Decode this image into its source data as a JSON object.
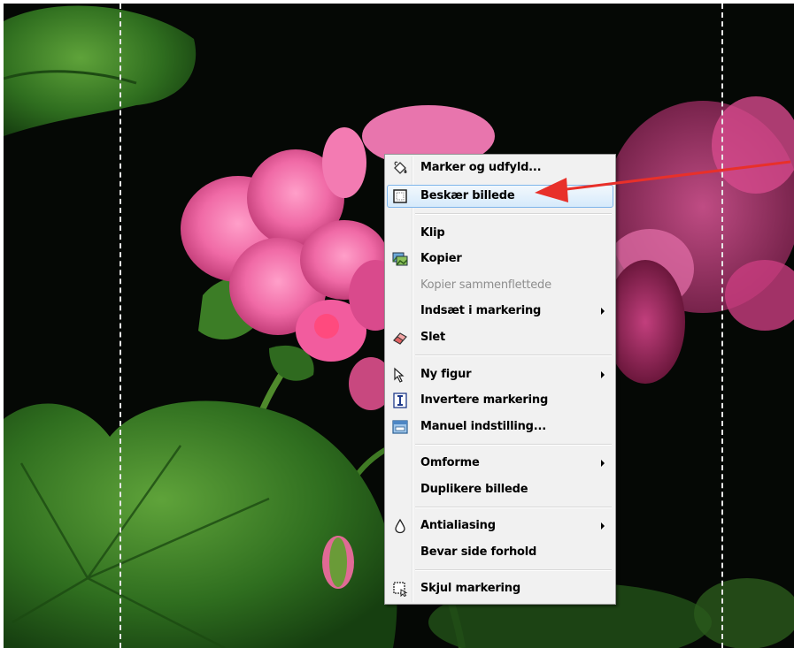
{
  "menu": {
    "items": [
      {
        "id": "marker-og-udfyld",
        "label": "Marker og udfyld...",
        "icon": "paint-bucket-icon"
      },
      {
        "id": "beskaer-billede",
        "label": "Beskær billede",
        "icon": "crop-icon",
        "highlighted": true
      },
      {
        "id": "klip",
        "label": "Klip",
        "icon": ""
      },
      {
        "id": "kopier",
        "label": "Kopier",
        "icon": "copy-image-icon"
      },
      {
        "id": "kopier-sammenflettede",
        "label": "Kopier sammenflettede",
        "icon": "",
        "disabled": true
      },
      {
        "id": "indsaet-i-markering",
        "label": "Indsæt i markering",
        "icon": "",
        "submenu": true
      },
      {
        "id": "slet",
        "label": "Slet",
        "icon": "eraser-icon"
      },
      {
        "id": "ny-figur",
        "label": "Ny figur",
        "icon": "pointer-icon",
        "submenu": true
      },
      {
        "id": "invertere-markering",
        "label": "Invertere markering",
        "icon": "invert-selection-icon"
      },
      {
        "id": "manuel-indstilling",
        "label": "Manuel indstilling...",
        "icon": "manual-settings-icon"
      },
      {
        "id": "omforme",
        "label": "Omforme",
        "icon": "",
        "submenu": true
      },
      {
        "id": "duplikere-billede",
        "label": "Duplikere billede",
        "icon": ""
      },
      {
        "id": "antialiasing",
        "label": "Antialiasing",
        "icon": "droplet-icon",
        "submenu": true
      },
      {
        "id": "bevar-side-forhold",
        "label": "Bevar side forhold",
        "icon": ""
      },
      {
        "id": "skjul-markering",
        "label": "Skjul markering",
        "icon": "hide-selection-icon"
      }
    ]
  },
  "colors": {
    "annotation_arrow": "#e8302a",
    "menu_background": "#f1f1f1",
    "highlight_border": "#7eb4ea",
    "selection_marquee": "#e6e6e6"
  }
}
